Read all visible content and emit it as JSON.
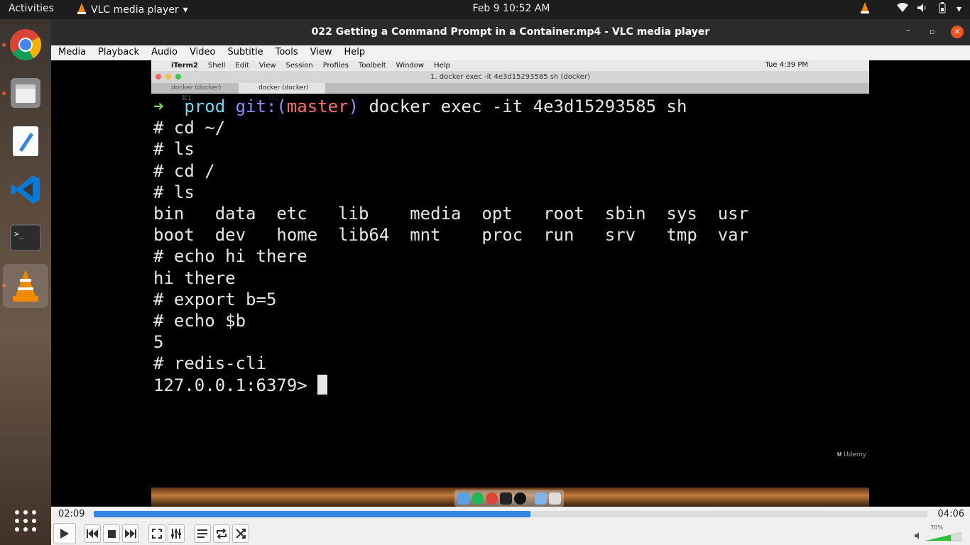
{
  "topbar": {
    "activities": "Activities",
    "app_name": "VLC media player",
    "clock": "Feb 9  10:52 AM"
  },
  "dock": {
    "apps": [
      "chrome-icon",
      "files-icon",
      "text-editor-icon",
      "vscode-icon",
      "terminal-icon",
      "vlc-icon",
      "show-apps-icon"
    ]
  },
  "window": {
    "title": "022 Getting a Command Prompt in a Container.mp4 - VLC media player"
  },
  "menu": {
    "items": [
      "Media",
      "Playback",
      "Audio",
      "Video",
      "Subtitle",
      "Tools",
      "View",
      "Help"
    ]
  },
  "video": {
    "mac_menu": {
      "app": "iTerm2",
      "items": [
        "Shell",
        "Edit",
        "View",
        "Session",
        "Profiles",
        "Toolbelt",
        "Window",
        "Help"
      ],
      "clock": "Tue 4:39 PM"
    },
    "iterm_title": "1. docker exec -it 4e3d15293585 sh (docker)",
    "tabs": [
      {
        "label": "docker (docker)",
        "shortcut": "⌘1"
      },
      {
        "label": "docker (docker)",
        "shortcut": "⌘2"
      }
    ],
    "prompt": {
      "arrow": "➜",
      "dir": "prod",
      "git_prefix": "git:(",
      "branch": "master",
      "git_suffix": ")",
      "command": "docker exec -it 4e3d15293585 sh"
    },
    "lines": [
      "# cd ~/",
      "# ls",
      "# cd /",
      "# ls",
      "bin   data  etc   lib    media  opt   root  sbin  sys  usr",
      "boot  dev   home  lib64  mnt    proc  run   srv   tmp  var",
      "# echo hi there",
      "hi there",
      "# export b=5",
      "# echo $b",
      "5",
      "# redis-cli"
    ],
    "last_prompt": "127.0.0.1:6379> ",
    "watermark": "Udemy"
  },
  "controls": {
    "current_time": "02:09",
    "total_time": "04:06",
    "progress": 0.524,
    "volume_label": "70%",
    "volume": 0.7
  }
}
